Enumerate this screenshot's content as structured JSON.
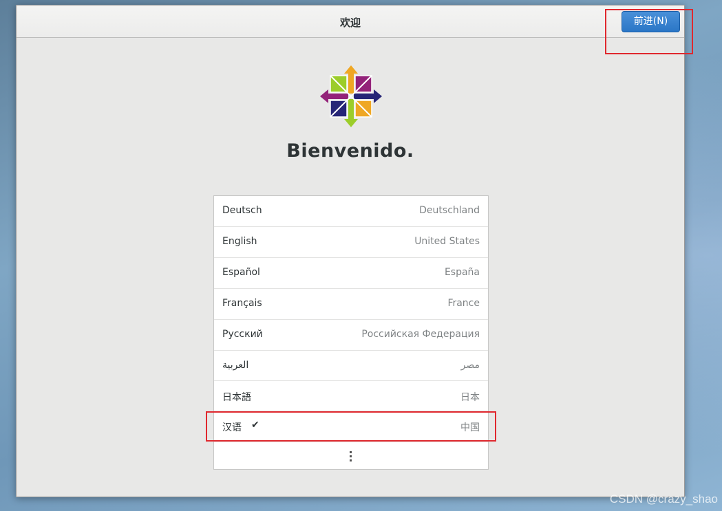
{
  "window": {
    "title": "欢迎",
    "next_button_label": "前进(N)"
  },
  "welcome": {
    "heading": "Bienvenido.",
    "logo_icon": "centos-logo-icon"
  },
  "languages": [
    {
      "name": "Deutsch",
      "region": "Deutschland",
      "selected": false
    },
    {
      "name": "English",
      "region": "United States",
      "selected": false
    },
    {
      "name": "Español",
      "region": "España",
      "selected": false
    },
    {
      "name": "Français",
      "region": "France",
      "selected": false
    },
    {
      "name": "Русский",
      "region": "Российская Федерация",
      "selected": false
    },
    {
      "name": "العربية",
      "region": "مصر",
      "selected": false
    },
    {
      "name": "日本語",
      "region": "日本",
      "selected": false
    },
    {
      "name": "汉语",
      "region": "中国",
      "selected": true,
      "check_glyph": "✔"
    }
  ],
  "more_icon": "vertical-ellipsis-icon",
  "watermark": "CSDN @crazy_shao",
  "colors": {
    "accent": "#2a76c6",
    "annotation": "#e0282e"
  }
}
